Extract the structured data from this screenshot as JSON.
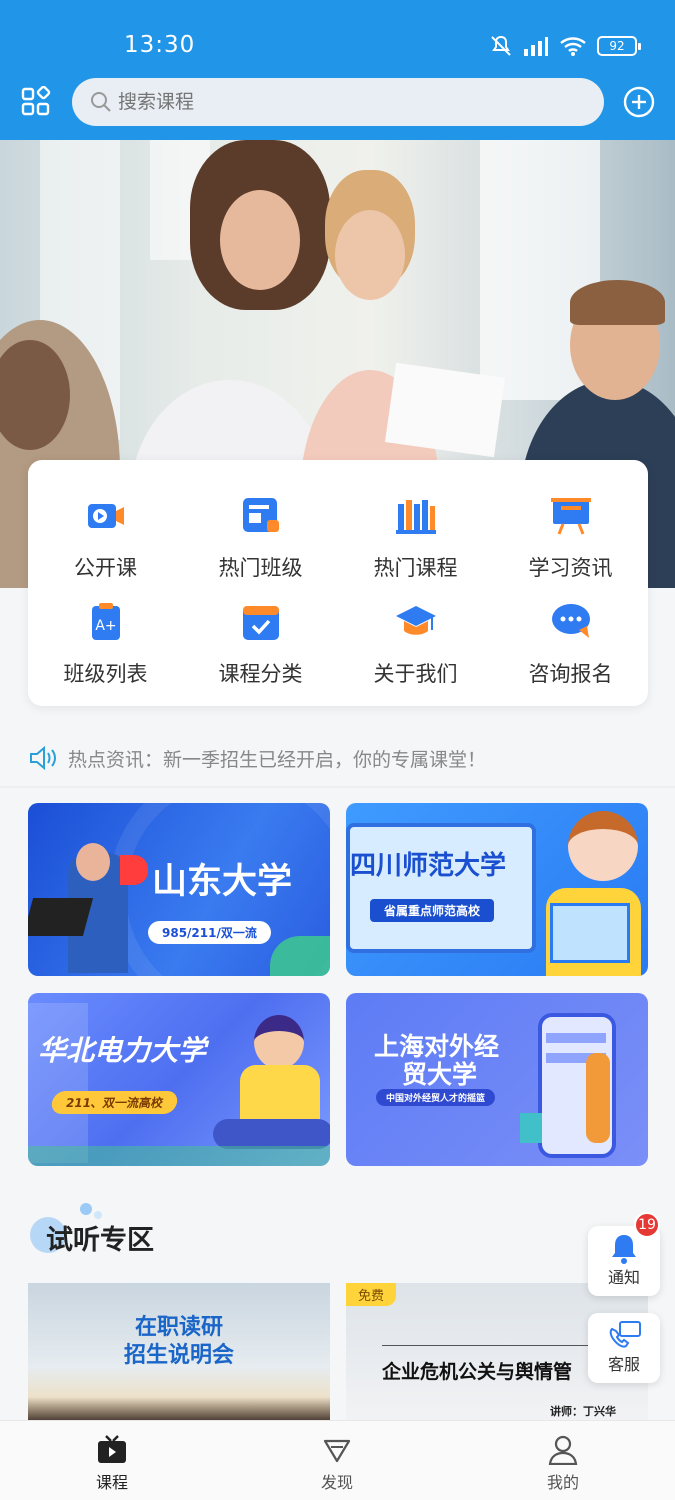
{
  "status": {
    "time": "13:30",
    "battery": "92"
  },
  "search": {
    "placeholder": "搜索课程"
  },
  "quick_menu": [
    {
      "label": "公开课",
      "icon": "video-icon"
    },
    {
      "label": "热门班级",
      "icon": "class-icon"
    },
    {
      "label": "热门课程",
      "icon": "books-icon"
    },
    {
      "label": "学习资讯",
      "icon": "easel-icon"
    },
    {
      "label": "班级列表",
      "icon": "clipboard-icon"
    },
    {
      "label": "课程分类",
      "icon": "calendar-check-icon"
    },
    {
      "label": "关于我们",
      "icon": "graduation-cap-icon"
    },
    {
      "label": "咨询报名",
      "icon": "chat-bubble-icon"
    }
  ],
  "news": {
    "text": "热点资讯：新一季招生已经开启，你的专属课堂！"
  },
  "banners": [
    {
      "title": "山东大学",
      "tag": "985/211/双一流"
    },
    {
      "title": "四川师范大学",
      "tag": "省属重点师范高校"
    },
    {
      "title": "华北电力大学",
      "tag": "211、双一流高校"
    },
    {
      "title_line1": "上海对外经",
      "title_line2": "贸大学",
      "tag": "中国对外经贸人才的摇篮"
    }
  ],
  "trial": {
    "section_title": "试听专区",
    "card1_line1": "在职读研",
    "card1_line2": "招生说明会",
    "card2_badge": "免费",
    "card2_title": "企业危机公关与舆情管",
    "card2_teacher": "讲师：丁兴华"
  },
  "float": {
    "notice_label": "通知",
    "notice_count": "19",
    "service_label": "客服"
  },
  "tabs": [
    {
      "label": "课程",
      "icon": "tv-icon"
    },
    {
      "label": "发现",
      "icon": "diamond-icon"
    },
    {
      "label": "我的",
      "icon": "person-icon"
    }
  ],
  "colors": {
    "brand": "#2196e8",
    "accent_orange": "#ff8a2a",
    "badge_red": "#e53935"
  }
}
